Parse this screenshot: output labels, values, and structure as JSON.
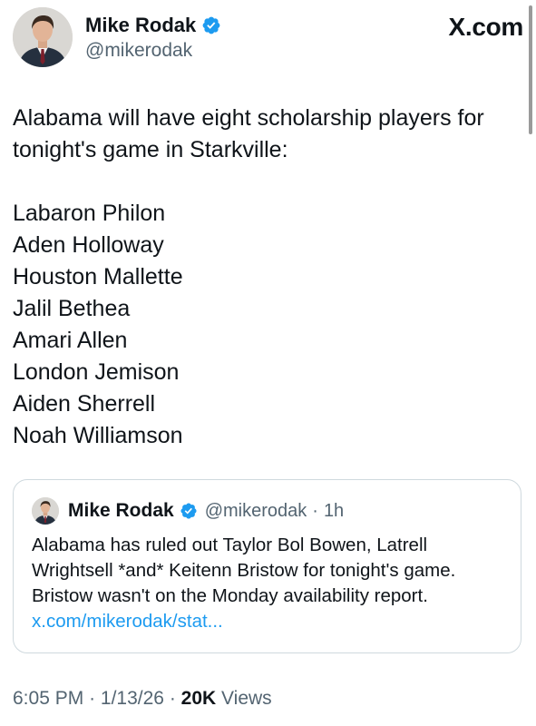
{
  "author": {
    "display_name": "Mike Rodak",
    "handle": "@mikerodak",
    "verified": true
  },
  "site_label": "X.com",
  "tweet": {
    "intro": "Alabama will have eight scholarship players for tonight's game in Starkville:",
    "players": [
      "Labaron Philon",
      "Aden Holloway",
      "Houston Mallette",
      "Jalil Bethea",
      "Amari Allen",
      "London Jemison",
      "Aiden Sherrell",
      "Noah Williamson"
    ]
  },
  "quoted_tweet": {
    "display_name": "Mike Rodak",
    "handle": "@mikerodak",
    "separator": "·",
    "time": "1h",
    "text": "Alabama has ruled out Taylor Bol Bowen, Latrell Wrightsell *and* Keitenn Bristow for tonight's game. Bristow wasn't on the Monday availability report.",
    "link": "x.com/mikerodak/stat..."
  },
  "meta": {
    "time": "6:05 PM",
    "date": "1/13/26",
    "separator": "·",
    "views_count": "20K",
    "views_label": "Views"
  },
  "colors": {
    "verified_badge": "#1d9bf0",
    "link": "#1d9bf0",
    "secondary_text": "#536471",
    "primary_text": "#0f1419",
    "card_border": "#cfd9de"
  },
  "icons": {
    "verified": "verified-badge-icon"
  }
}
